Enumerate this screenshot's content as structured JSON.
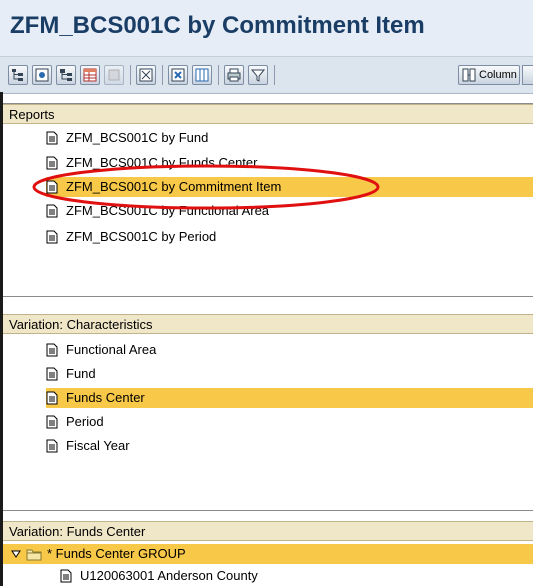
{
  "window": {
    "title": "ZFM_BCS001C by Commitment Item"
  },
  "toolbar": {
    "buttons": [
      {
        "icon": "hierarchy-icon"
      },
      {
        "icon": "settings-icon"
      },
      {
        "icon": "expand-tree-icon"
      },
      {
        "icon": "layout-icon"
      },
      {
        "icon": "disabled-icon"
      },
      {
        "icon": "filter-icon"
      },
      {
        "icon": "drilldown-icon"
      },
      {
        "icon": "columns-icon"
      },
      {
        "icon": "print-icon"
      },
      {
        "icon": "sort-filter-icon"
      }
    ],
    "column_label": "Column"
  },
  "reports": {
    "header": "Reports",
    "items": [
      {
        "label": "ZFM_BCS001C by Fund",
        "selected": false
      },
      {
        "label": "ZFM_BCS001C by Funds Center",
        "selected": false
      },
      {
        "label": "ZFM_BCS001C by Commitment Item",
        "selected": true
      },
      {
        "label": "ZFM_BCS001C by Functional Area",
        "selected": false
      },
      {
        "label": "ZFM_BCS001C by Period",
        "selected": false
      }
    ]
  },
  "characteristics": {
    "header": "Variation: Characteristics",
    "items": [
      {
        "label": "Functional Area",
        "selected": false
      },
      {
        "label": "Fund",
        "selected": false
      },
      {
        "label": "Funds Center",
        "selected": true
      },
      {
        "label": "Period",
        "selected": false
      },
      {
        "label": "Fiscal Year",
        "selected": false
      }
    ]
  },
  "funds_center": {
    "header": "Variation: Funds Center",
    "group_label": "* Funds Center GROUP",
    "child_label": "U120063001 Anderson County"
  },
  "colors": {
    "selection": "#f8c848",
    "panel_header": "#f0e6c8",
    "title_text": "#1a3d66",
    "highlight_ellipse": "#e01010"
  }
}
